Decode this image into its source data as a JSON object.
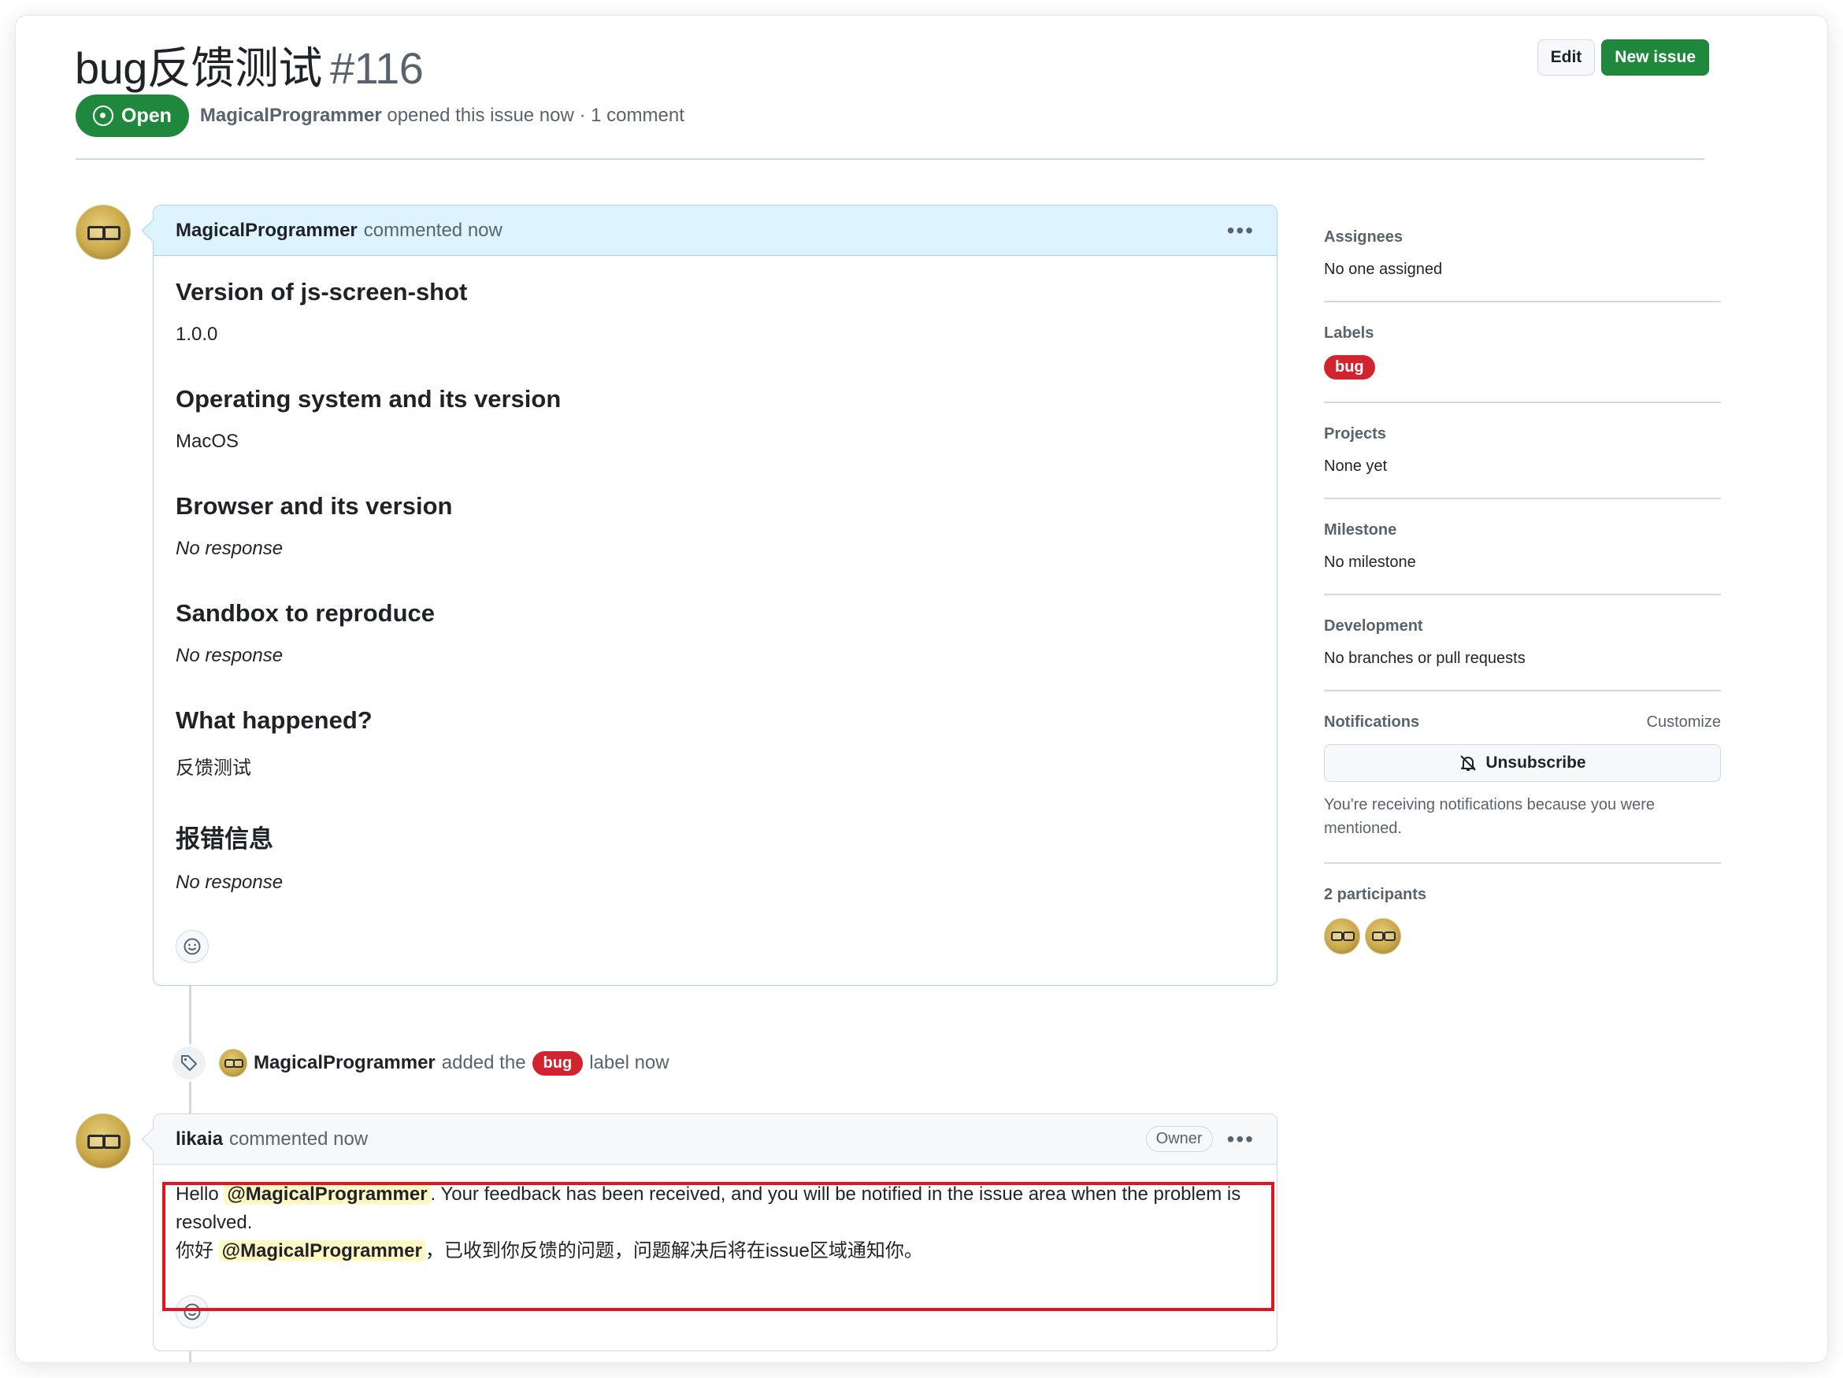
{
  "issue": {
    "title": "bug反馈测试",
    "number": "#116",
    "state": "Open",
    "author": "MagicalProgrammer",
    "meta_text": "opened this issue now · 1 comment"
  },
  "header_buttons": {
    "edit": "Edit",
    "new_issue": "New issue"
  },
  "comment1": {
    "author": "MagicalProgrammer",
    "time": "commented now",
    "sections": [
      {
        "heading": "Version of js-screen-shot",
        "value": "1.0.0",
        "italic": false
      },
      {
        "heading": "Operating system and its version",
        "value": "MacOS",
        "italic": false
      },
      {
        "heading": "Browser and its version",
        "value": "No response",
        "italic": true
      },
      {
        "heading": "Sandbox to reproduce",
        "value": "No response",
        "italic": true
      },
      {
        "heading": "What happened?",
        "value": "反馈测试",
        "italic": false
      },
      {
        "heading": "报错信息",
        "value": "No response",
        "italic": true
      }
    ]
  },
  "event": {
    "actor": "MagicalProgrammer",
    "pre": "added the",
    "label": "bug",
    "post": "label now"
  },
  "comment2": {
    "author": "likaia",
    "time": "commented now",
    "badge": "Owner",
    "line1_pre": "Hello",
    "mention": "@MagicalProgrammer",
    "line1_post": ". Your feedback has been received, and you will be notified in the issue area when the problem is resolved.",
    "line2_pre": "你好",
    "line2_post": "，已收到你反馈的问题，问题解决后将在issue区域通知你。"
  },
  "sidebar": {
    "assignees": {
      "title": "Assignees",
      "value": "No one assigned"
    },
    "labels": {
      "title": "Labels",
      "value": "bug"
    },
    "projects": {
      "title": "Projects",
      "value": "None yet"
    },
    "milestone": {
      "title": "Milestone",
      "value": "No milestone"
    },
    "development": {
      "title": "Development",
      "value": "No branches or pull requests"
    },
    "notifications": {
      "title": "Notifications",
      "customize": "Customize",
      "button": "Unsubscribe",
      "text": "You're receiving notifications because you were mentioned."
    },
    "participants": {
      "title": "2 participants"
    }
  },
  "colors": {
    "open_green": "#1f883d",
    "label_red": "#d1242f",
    "comment_header_blue": "#ddf4ff",
    "mention_yellow": "#fff8c5",
    "annotation_red": "#e3141c"
  }
}
